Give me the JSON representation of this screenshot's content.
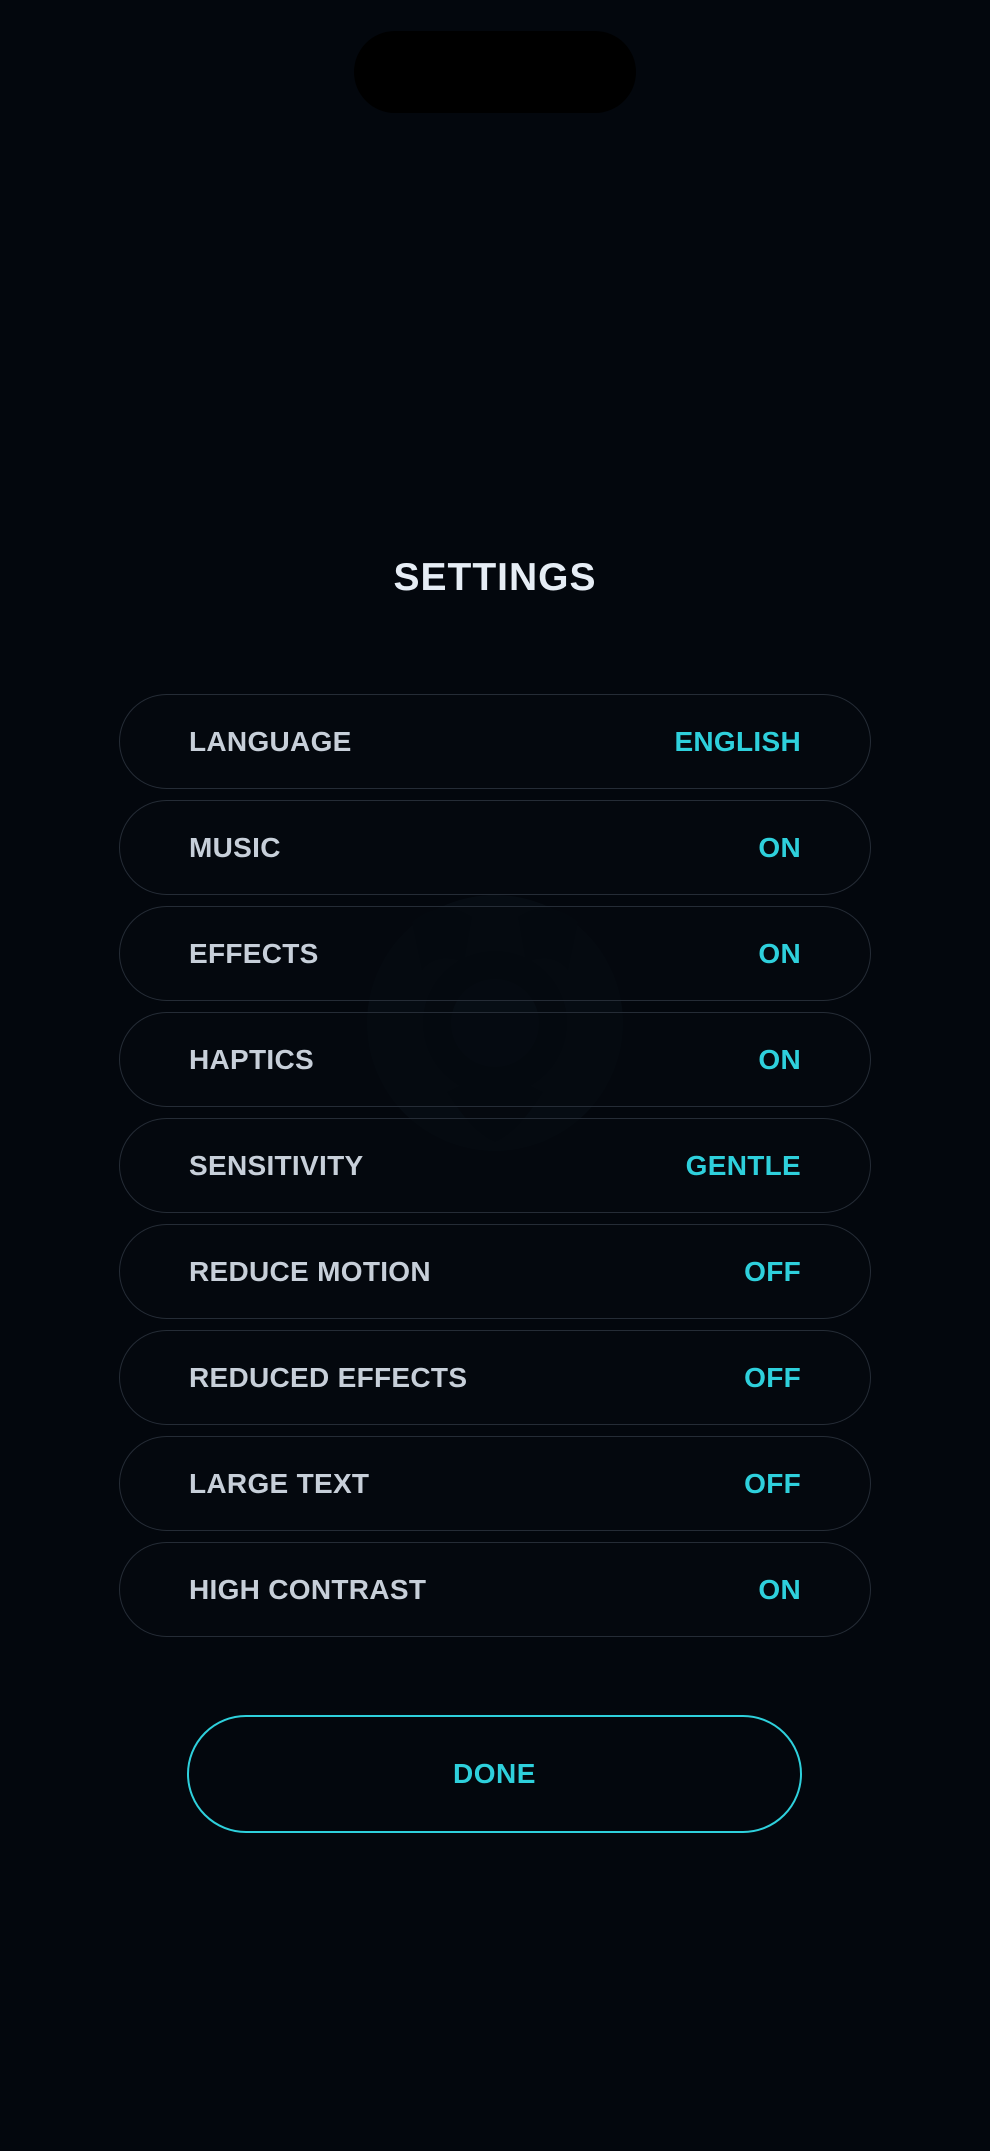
{
  "screen": {
    "title": "SETTINGS"
  },
  "settings": [
    {
      "label": "LANGUAGE",
      "value": "ENGLISH"
    },
    {
      "label": "MUSIC",
      "value": "ON"
    },
    {
      "label": "EFFECTS",
      "value": "ON"
    },
    {
      "label": "HAPTICS",
      "value": "ON"
    },
    {
      "label": "SENSITIVITY",
      "value": "GENTLE"
    },
    {
      "label": "REDUCE MOTION",
      "value": "OFF"
    },
    {
      "label": "REDUCED EFFECTS",
      "value": "OFF"
    },
    {
      "label": "LARGE TEXT",
      "value": "OFF"
    },
    {
      "label": "HIGH CONTRAST",
      "value": "ON"
    }
  ],
  "actions": {
    "done_label": "DONE"
  },
  "colors": {
    "background": "#03070d",
    "accent": "#2ed0dc",
    "label": "#c7cfd9",
    "title": "#e6edf5",
    "row_border": "#252c36"
  }
}
